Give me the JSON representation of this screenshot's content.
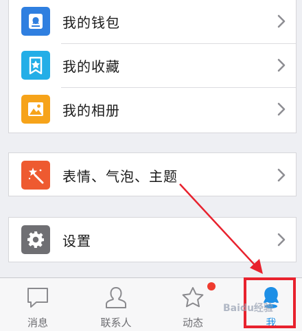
{
  "menu_group_1": {
    "items": [
      {
        "label": "我的钱包",
        "icon": "wallet-icon",
        "color": "#2f7fe0"
      },
      {
        "label": "我的收藏",
        "icon": "favorite-star-icon",
        "color": "#23aee7"
      },
      {
        "label": "我的相册",
        "icon": "photo-album-icon",
        "color": "#f6a31a"
      }
    ]
  },
  "menu_group_2": {
    "items": [
      {
        "label": "表情、气泡、主题",
        "icon": "magic-wand-icon",
        "color": "#ee5a30"
      }
    ]
  },
  "menu_group_3": {
    "items": [
      {
        "label": "设置",
        "icon": "gear-icon",
        "color": "#6f6f73"
      }
    ]
  },
  "tabbar": {
    "tabs": [
      {
        "label": "消息",
        "icon": "message-bubble-icon"
      },
      {
        "label": "联系人",
        "icon": "contacts-person-icon"
      },
      {
        "label": "动态",
        "icon": "star-activity-icon",
        "has_badge": true
      },
      {
        "label": "我",
        "icon": "qq-penguin-icon",
        "selected": true
      }
    ],
    "active_color": "#1d8fe6",
    "badge_color": "#ef3b2f"
  },
  "annotation": {
    "highlight_color": "#e8222e"
  },
  "watermark": {
    "text": "Baidu经验"
  }
}
